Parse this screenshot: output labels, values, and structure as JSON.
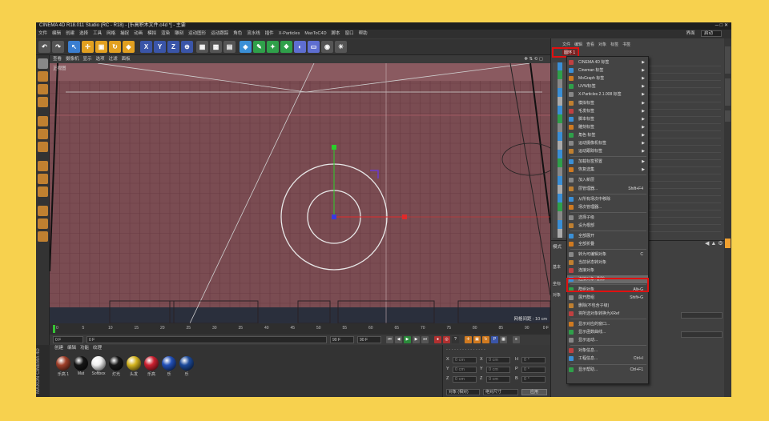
{
  "window": {
    "title": "CINEMA 4D R18.011 Studio (RC - R18) - [乐高积木文件.c4d *] - 主要"
  },
  "menubar": {
    "items": [
      "文件",
      "编辑",
      "创建",
      "选择",
      "工具",
      "网格",
      "捕捉",
      "动画",
      "模拟",
      "渲染",
      "雕刻",
      "运动图形",
      "运动跟踪",
      "角色",
      "流水线",
      "插件",
      "X-Particles",
      "MaxToC4D",
      "脚本",
      "窗口",
      "帮助"
    ],
    "layout_label": "界面",
    "layout_value": "启动"
  },
  "toolbar": {
    "axis_labels": [
      "X",
      "Y",
      "Z"
    ]
  },
  "viewport": {
    "menu": [
      "查看",
      "摄像机",
      "显示",
      "选项",
      "过滤",
      "面板"
    ],
    "label": "正视图",
    "grid_info": "网格间距 : 10 cm"
  },
  "timeline": {
    "ticks": [
      "0",
      "5",
      "10",
      "15",
      "20",
      "25",
      "30",
      "35",
      "40",
      "45",
      "50",
      "55",
      "60",
      "65",
      "70",
      "75",
      "80",
      "85",
      "90"
    ],
    "end_frame": "0 F"
  },
  "transport": {
    "start": "0 F",
    "current": "0 F",
    "end": "90 F",
    "end2": "90 F"
  },
  "materials": {
    "menu": [
      "创建",
      "编辑",
      "功能",
      "纹理"
    ],
    "items": [
      {
        "label": "乐高 1",
        "color": "#a0402a"
      },
      {
        "label": "Mat",
        "color": "#151515"
      },
      {
        "label": "Softbox",
        "color": "#f0f0f0"
      },
      {
        "label": "灯光",
        "color": "#181818"
      },
      {
        "label": "头发",
        "color": "#d4b420"
      },
      {
        "label": "乐高",
        "color": "#cc2030"
      },
      {
        "label": "乐",
        "color": "#2250b8"
      },
      {
        "label": "乐",
        "color": "#1c4a9a"
      }
    ],
    "brand": "MAXON CINEMA 4D"
  },
  "coords": {
    "rows": [
      {
        "axis": "X",
        "pos": "0 cm",
        "size": "0 cm",
        "rot_label": "H",
        "rot": "0 °"
      },
      {
        "axis": "Y",
        "pos": "0 cm",
        "size": "0 cm",
        "rot_label": "P",
        "rot": "0 °"
      },
      {
        "axis": "Z",
        "pos": "0 cm",
        "size": "0 cm",
        "rot_label": "B",
        "rot": "0 °"
      }
    ],
    "mode1": "对象 (相对)",
    "mode2": "绝对尺寸",
    "apply": "应用"
  },
  "rightpanel": {
    "tabs": [
      "文件",
      "编辑",
      "查看",
      "对象",
      "标签",
      "书签"
    ],
    "selected_object": "圆环 1",
    "attr_tab": "模式",
    "attr_items": [
      "基本",
      "坐标",
      "对象"
    ]
  },
  "context_menu": {
    "items": [
      {
        "label": "CINEMA 4D 标签",
        "sub": true
      },
      {
        "label": "Cineman 标签",
        "sub": true
      },
      {
        "label": "MoGraph 标签",
        "sub": true
      },
      {
        "label": "UVW标签",
        "sub": true
      },
      {
        "label": "X-Particles 2.1.008 标签",
        "sub": true
      },
      {
        "label": "模拟标签",
        "sub": true
      },
      {
        "label": "毛发标签",
        "sub": true
      },
      {
        "label": "脚本标签",
        "sub": true
      },
      {
        "label": "雕刻标签",
        "sub": true
      },
      {
        "label": "角色 标签",
        "sub": true
      },
      {
        "label": "运动摄像机标签",
        "sub": true
      },
      {
        "label": "运动跟踪标签",
        "sub": true
      },
      {
        "sep": true
      },
      {
        "label": "加载标签预置",
        "sub": true
      },
      {
        "label": "恢复选集",
        "sub": true
      },
      {
        "sep": true
      },
      {
        "label": "加入新层"
      },
      {
        "label": "层管理器...",
        "sc": "Shift+F4"
      },
      {
        "sep": true
      },
      {
        "label": "从所有场次中移除"
      },
      {
        "label": "场次管理器..."
      },
      {
        "sep": true
      },
      {
        "label": "选择子级"
      },
      {
        "label": "设为根部"
      },
      {
        "sep": true
      },
      {
        "label": "全部展开"
      },
      {
        "label": "全部折叠"
      },
      {
        "sep": true
      },
      {
        "label": "转为可编辑对象",
        "sc": "C"
      },
      {
        "label": "当前状态转对象"
      },
      {
        "label": "连接对象"
      },
      {
        "label": "连接对象+删除",
        "hl": true
      },
      {
        "sep": true
      },
      {
        "label": "群组对象",
        "sc": "Alt+G"
      },
      {
        "label": "展开群组",
        "sc": "Shift+G"
      },
      {
        "label": "删除(不包含子级)"
      },
      {
        "label": "将所选对象转换为XRef"
      },
      {
        "sep": true
      },
      {
        "label": "显示对应的窗口..."
      },
      {
        "label": "显示函数曲线..."
      },
      {
        "label": "显示运动..."
      },
      {
        "sep": true
      },
      {
        "label": "对象信息..."
      },
      {
        "label": "工程信息...",
        "sc": "Ctrl+I"
      },
      {
        "sep": true
      },
      {
        "label": "显示帮助...",
        "sc": "Ctrl+F1"
      }
    ]
  },
  "colors": {
    "viewport": "#7a4c52",
    "highlight": "#e01010",
    "accent": "#f0a030"
  }
}
